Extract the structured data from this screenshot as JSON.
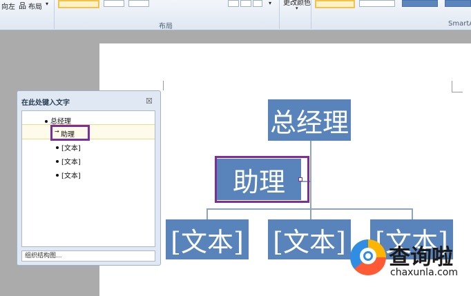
{
  "ribbon": {
    "btn_right_to_left": "向左",
    "btn_layout": "布局",
    "btn_layout_arrow": "▾",
    "layout_group_label": "布局",
    "change_colors_label": "更改颜色",
    "smartart_group_label": "SmartArt"
  },
  "text_pane": {
    "title": "在此处键入文字",
    "close": "☒",
    "items": [
      "总经理",
      "助理",
      "[文本]",
      "[文本]",
      "[文本]"
    ],
    "footer": "组织结构图..."
  },
  "diagram": {
    "top": "总经理",
    "assistant": "助理",
    "sub1": "[文本]",
    "sub2": "[文本]",
    "sub3": "[文本]"
  },
  "watermark": {
    "name": "查询啦",
    "url": "chaxunla.com"
  },
  "colors": {
    "shape_fill": "#5884BB",
    "selection": "#7B2E9C",
    "canvas": "#ABABAB"
  }
}
